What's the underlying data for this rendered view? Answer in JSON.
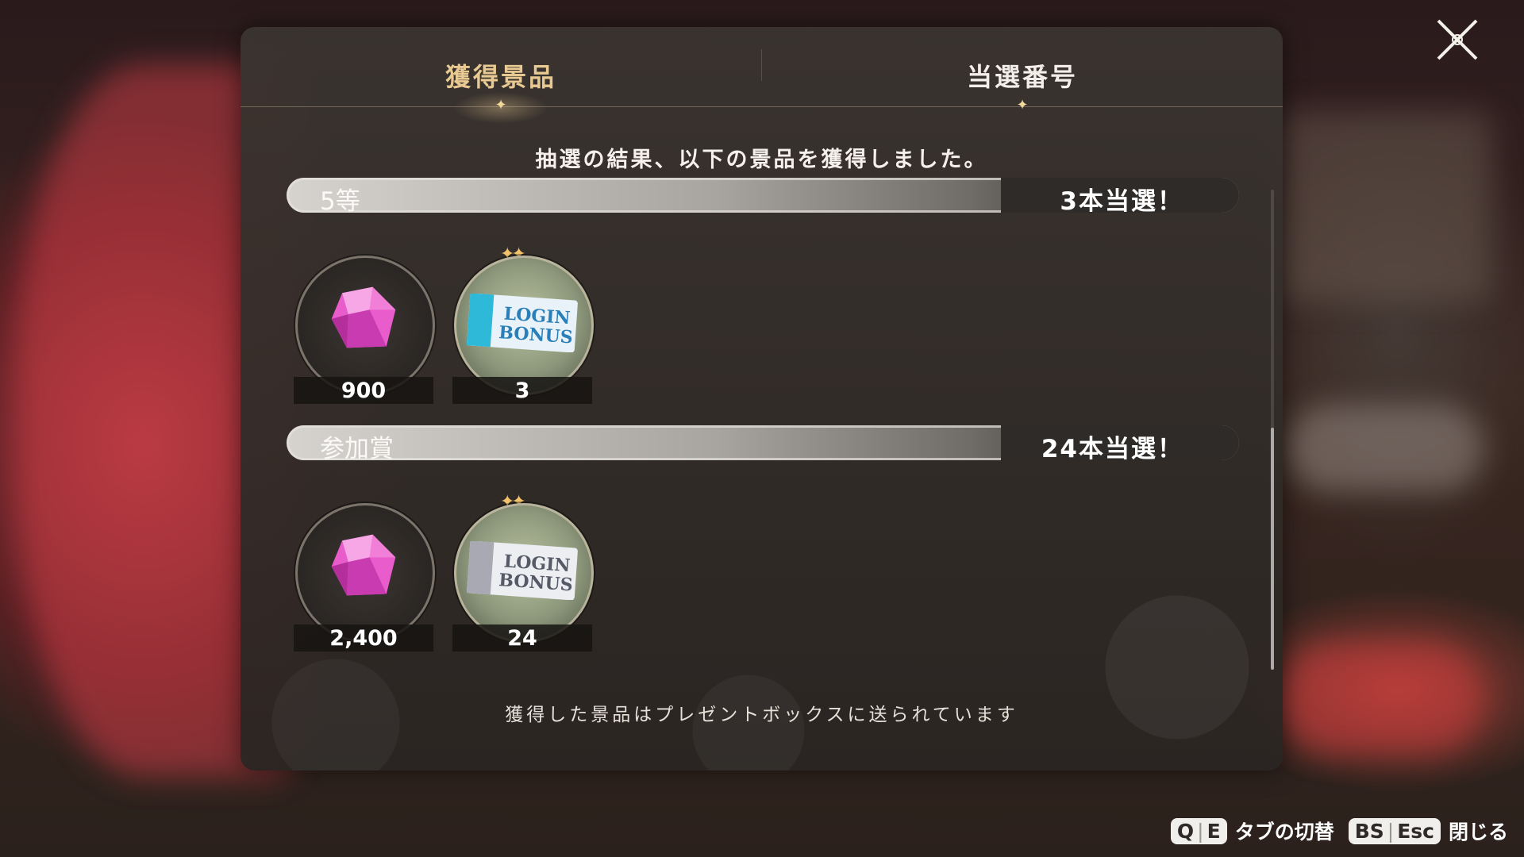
{
  "tabs": [
    {
      "label": "獲得景品",
      "active": true
    },
    {
      "label": "当選番号",
      "active": false
    }
  ],
  "subtitle": "抽選の結果、以下の景品を獲得しました。",
  "ranks": [
    {
      "name": "5等",
      "count": "3本当選！",
      "items": [
        {
          "icon": "gem-icon",
          "amount": "900"
        },
        {
          "icon": "login-bonus-ticket-blue-icon",
          "amount": "3"
        }
      ]
    },
    {
      "name": "参加賞",
      "count": "24本当選！",
      "items": [
        {
          "icon": "gem-icon",
          "amount": "2,400"
        },
        {
          "icon": "login-bonus-ticket-silver-icon",
          "amount": "24"
        }
      ]
    }
  ],
  "ticket_text": {
    "line1": "LOGIN",
    "line2": "BONUS"
  },
  "footer_note": "獲得した景品はプレゼントボックスに送られています",
  "hints": {
    "tab_key1": "Q",
    "tab_key2": "E",
    "tab_switch_label": "タブの切替",
    "close_key1": "BS",
    "close_key2": "Esc",
    "close_label": "閉じる"
  },
  "colors": {
    "active_tab": "#e8c992",
    "gem": "#e24fc4",
    "ticket_blue": "#2fb9d8",
    "ticket_silver": "#a9a9b3"
  }
}
